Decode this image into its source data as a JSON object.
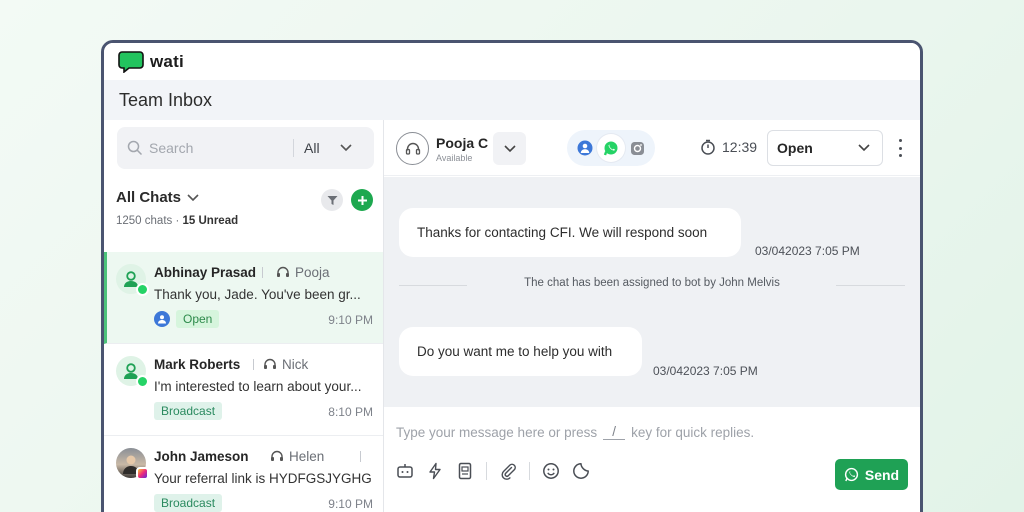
{
  "app": {
    "name": "wati"
  },
  "header": {
    "title": "Team Inbox"
  },
  "search": {
    "placeholder": "Search",
    "filter": "All"
  },
  "list_header": {
    "title": "All Chats",
    "count": "1250 chats",
    "separator": "·",
    "unread": "15 Unread"
  },
  "chats": [
    {
      "name": "Abhinay Prasad",
      "agent": "Pooja",
      "message": "Thank you, Jade. You've been gr...",
      "tag": "Open",
      "time": "9:10 PM"
    },
    {
      "name": "Mark Roberts",
      "agent": "Nick",
      "message": "I'm interested to learn about your...",
      "tag": "Broadcast",
      "time": "8:10 PM"
    },
    {
      "name": "John Jameson",
      "agent": "Helen",
      "message": "Your referral link is HYDFGSJYGHG",
      "tag": "Broadcast",
      "time": "9:10 PM"
    }
  ],
  "conversation": {
    "contact_name": "Pooja C",
    "contact_status": "Available",
    "timer": "12:39",
    "status": "Open",
    "messages": [
      {
        "text": "Thanks for contacting CFI. We will respond soon",
        "time": "03/042023 7:05 PM"
      },
      {
        "text": "Do you want me to help you with",
        "time": "03/042023 7:05 PM"
      }
    ],
    "system_message": "The chat has been assigned to bot by John Melvis"
  },
  "composer": {
    "placeholder_before": "Type your message here or press",
    "shortcut_key": "/",
    "placeholder_after": "key for quick replies.",
    "send_label": "Send"
  },
  "colors": {
    "brand_green": "#1fa155",
    "whatsapp_green": "#25d366",
    "frame": "#4a5470"
  }
}
